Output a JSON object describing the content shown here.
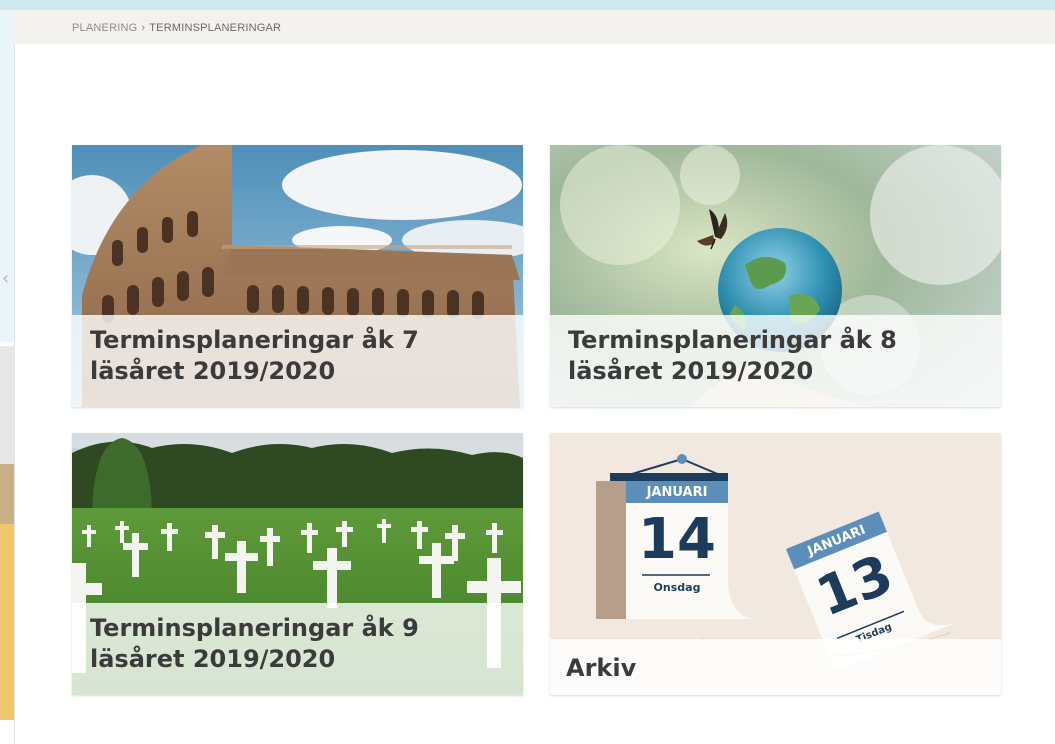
{
  "breadcrumb": {
    "parent": "PLANERING",
    "separator": "›",
    "current": "TERMINSPLANERINGAR"
  },
  "cards": [
    {
      "title_line1": "Terminsplaneringar åk 7",
      "title_line2": "läsåret 2019/2020",
      "image": "colosseum"
    },
    {
      "title_line1": "Terminsplaneringar åk 8",
      "title_line2": "läsåret 2019/2020",
      "image": "butterfly-globe"
    },
    {
      "title_line1": "Terminsplaneringar åk 9",
      "title_line2": "läsåret 2019/2020",
      "image": "war-cemetery"
    },
    {
      "title": "Arkiv",
      "image": "calendar-pages"
    }
  ],
  "calendar": {
    "page1": {
      "month": "JANUARI",
      "day": "14",
      "weekday": "Onsdag"
    },
    "page2": {
      "month": "JANUARI",
      "day": "13",
      "weekday": "Tisdag"
    }
  },
  "colors": {
    "text": "#3b3b3b",
    "breadcrumb": "#8f8a82",
    "calendar_blue": "#5b8fba",
    "calendar_navy": "#1d3c5b",
    "archive_bg": "#f1e8df"
  }
}
